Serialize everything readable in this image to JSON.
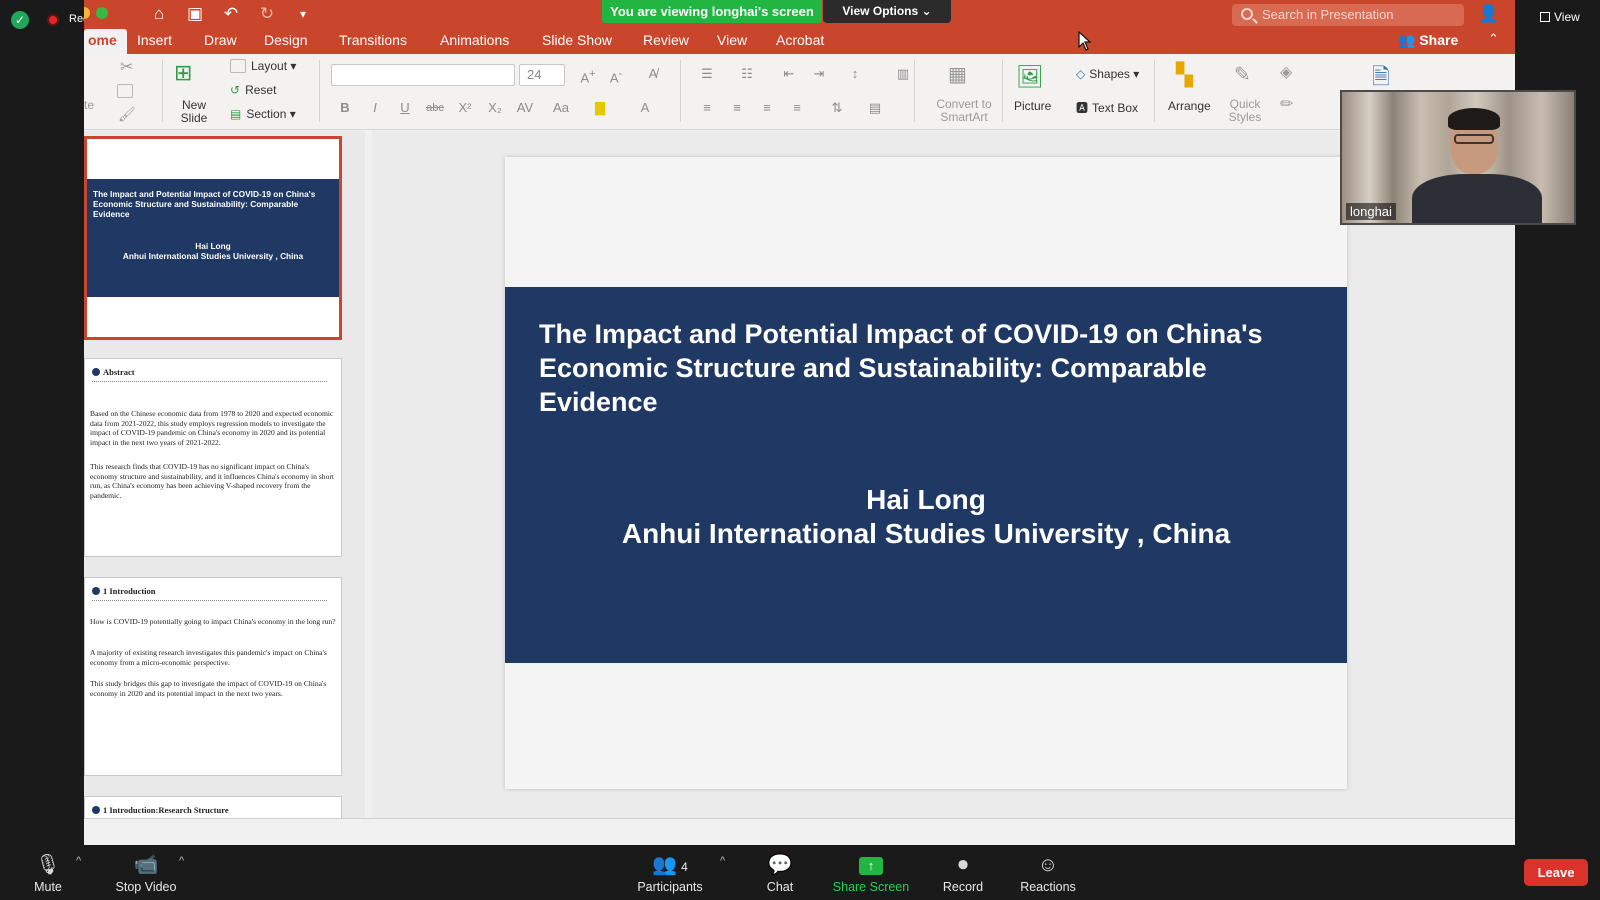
{
  "zoom": {
    "recording_label": "Recording",
    "banner_text": "You are viewing longhai's screen",
    "view_options_label": "View Options",
    "view_label": "View",
    "participant_name": "longhai",
    "participants_count": "4",
    "toolbar": {
      "mute": "Mute",
      "stop_video": "Stop Video",
      "participants": "Participants",
      "chat": "Chat",
      "share_screen": "Share Screen",
      "record": "Record",
      "reactions": "Reactions",
      "leave": "Leave"
    },
    "colors": {
      "share_green": "#23b541",
      "leave_red": "#d9332c",
      "recording_red": "#e02828"
    }
  },
  "ppt": {
    "search_placeholder": "Search in Presentation",
    "share_label": "Share",
    "tabs": [
      "ome",
      "Insert",
      "Draw",
      "Design",
      "Transitions",
      "Animations",
      "Slide Show",
      "Review",
      "View",
      "Acrobat"
    ],
    "ribbon": {
      "paste_label": "te",
      "new_slide": "New Slide",
      "layout": "Layout",
      "reset": "Reset",
      "section": "Section",
      "font_size": "24",
      "convert_smartart": "Convert to SmartArt",
      "picture": "Picture",
      "shapes": "Shapes",
      "text_box": "Text Box",
      "arrange": "Arrange",
      "quick_styles": "Quick Styles"
    },
    "thumbnails": {
      "t1": {
        "title": "The Impact and Potential Impact of COVID-19 on China's Economic Structure and Sustainability: Comparable Evidence",
        "author": "Hai Long",
        "affiliation": "Anhui International Studies University , China"
      },
      "t2": {
        "heading": "Abstract",
        "p1": "Based on the Chinese economic data from 1978 to 2020 and expected economic data from 2021-2022, this study employs regression models to investigate the impact of COVID-19 pandemic on China's economy in 2020 and its potential impact in the next two years of 2021-2022.",
        "p2": "This research finds that COVID-19 has no significant impact on China's economy structure and sustainability, and it influences China's economy in short run, as China's economy has been achieving V-shaped recovery from the pandemic."
      },
      "t3": {
        "heading": "1 Introduction",
        "p1": "How is COVID-19 potentially going to impact China's economy in the long run?",
        "p2": "A majority of existing research investigates this pandemic's impact on China's economy from a micro-economic perspective.",
        "p3": "This study bridges this gap to investigate the impact of COVID-19 on China's economy in 2020 and its potential impact in the next two years."
      },
      "t4": {
        "heading": "1 Introduction:Research Structure"
      }
    },
    "slide": {
      "title": "The Impact and Potential Impact of COVID-19 on China's Economic Structure and Sustainability: Comparable Evidence",
      "author": "Hai Long",
      "affiliation": "Anhui International Studies University , China"
    },
    "colors": {
      "accent": "#c9462c",
      "slide_band": "#1f3864"
    }
  }
}
